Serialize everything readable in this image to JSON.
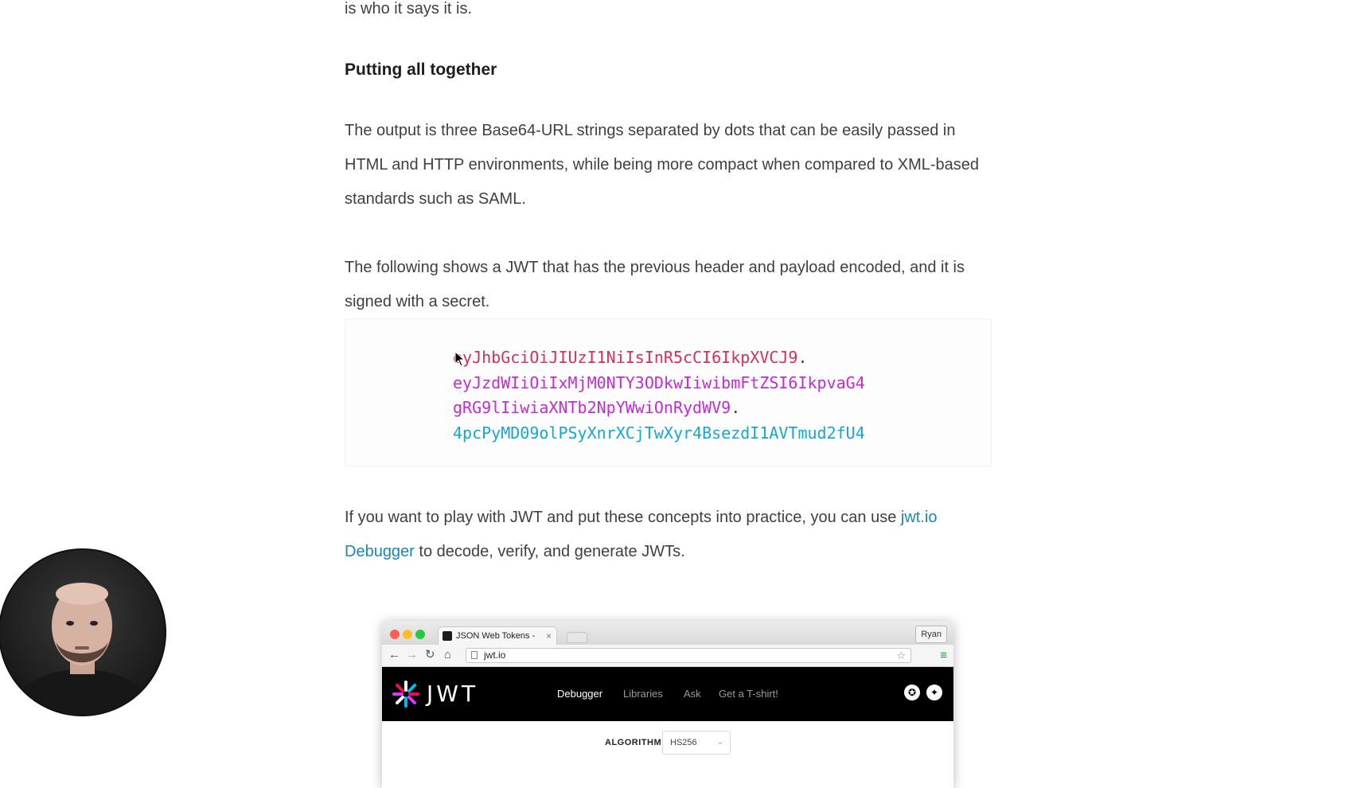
{
  "article": {
    "prev_line": "is who it says it is.",
    "heading": "Putting all together",
    "para1": "The output is three Base64-URL strings separated by dots that can be easily passed in HTML and HTTP environments, while being more compact when compared to XML-based standards such as SAML.",
    "para2": "The following shows a JWT that has the previous header and payload encoded, and it is signed with a secret.",
    "token": {
      "header": "eyJhbGciOiJIUzI1NiIsInR5cCI6IkpXVCJ9",
      "payload_line1": "eyJzdWIiOiIxMjM0NTY3ODkwIiwibmFtZSI6IkpvaG4",
      "payload_line2": "gRG9lIiwiaXNTb2NpYWwiOnRydWV9",
      "signature": "4pcPyMD09olPSyXnrXCjTwXyr4BsezdI1AVTmud2fU4",
      "dot": "."
    },
    "para3_before": "If you want to play with JWT and put these concepts into practice, you can use ",
    "para3_link": "jwt.io Debugger",
    "para3_after": " to decode, verify, and generate JWTs.",
    "colors": {
      "header": "#d6305a",
      "payload": "#c42bd6",
      "signature": "#16a6d3",
      "link": "#1b87b4"
    }
  },
  "browser": {
    "tab_title": "JSON Web Tokens - jwt.io",
    "tab_close": "×",
    "user": "Ryan",
    "url": "jwt.io",
    "logo_text": "JWT",
    "nav": [
      "Debugger",
      "Libraries",
      "Ask",
      "Get a T-shirt!"
    ],
    "algorithm_label": "ALGORITHM",
    "algorithm_value": "HS256"
  },
  "icons": [
    "back-arrow-icon",
    "forward-arrow-icon",
    "reload-icon",
    "home-icon",
    "star-icon",
    "menu-icon",
    "auth0-icon",
    "twitter-icon",
    "mouse-cursor-icon"
  ]
}
